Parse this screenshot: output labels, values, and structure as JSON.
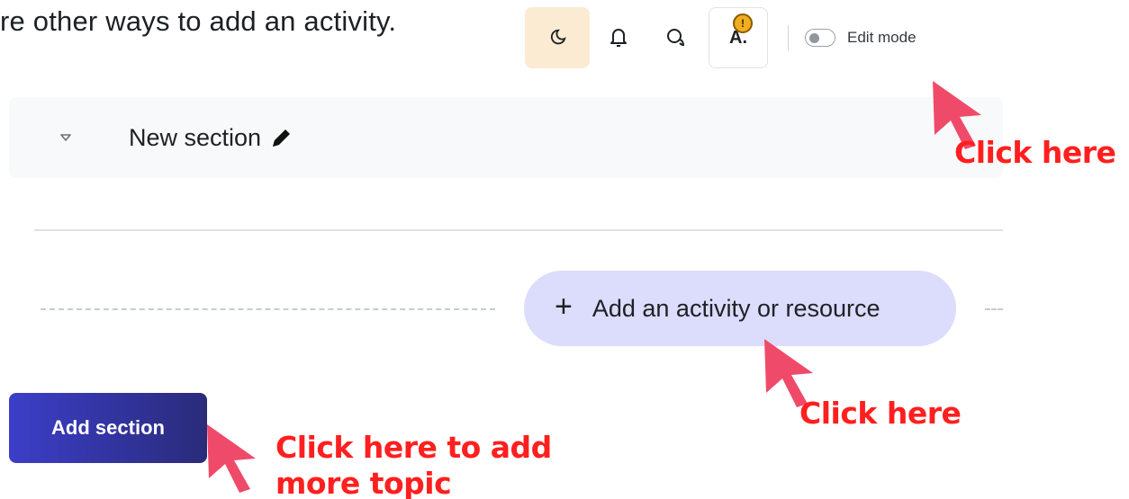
{
  "intro_text": "re other ways to add an activity.",
  "topbar": {
    "icons": [
      "moon-icon",
      "bell-icon",
      "chat-icon"
    ],
    "user_initials": "A.",
    "user_badge": "!",
    "edit_mode_label": "Edit mode"
  },
  "section": {
    "title": "New section",
    "collapse_icon": "triangle-down-icon",
    "edit_icon": "pencil-icon"
  },
  "add_activity": {
    "plus": "+",
    "label": "Add an activity or resource"
  },
  "add_section": {
    "label": "Add section"
  },
  "annotations": {
    "edit_mode_hint": "Click here",
    "activity_hint": "Click here",
    "section_hint_line1": "Click here to add",
    "section_hint_line2": "more topic"
  },
  "colors": {
    "annotation": "#ff1f1f",
    "cursor": "#f04a6a",
    "add_activity_bg": "#dcdcfd",
    "add_section_bg": "#3c3ec9",
    "darkmode_bg": "#fcebd3"
  }
}
